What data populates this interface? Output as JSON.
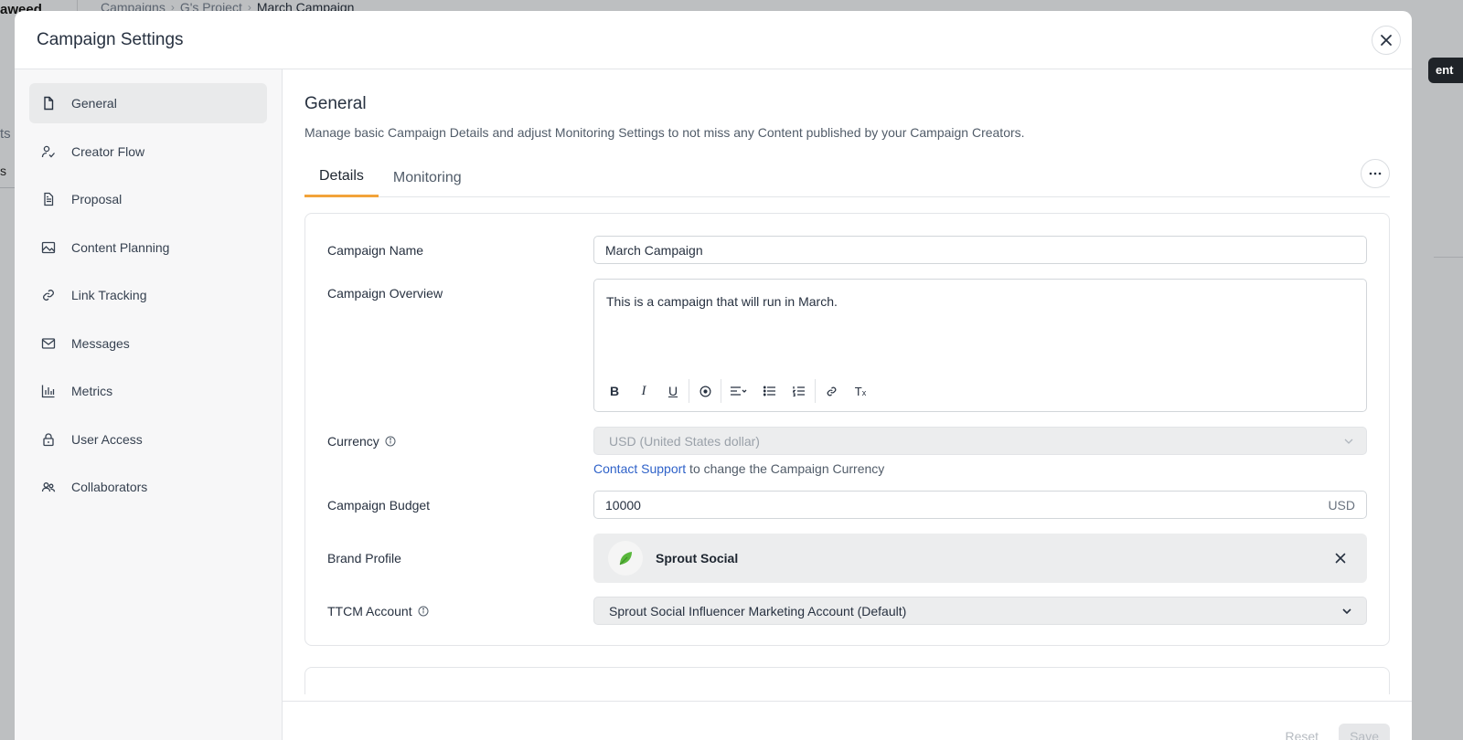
{
  "background": {
    "brand_partial": "aweed",
    "breadcrumbs": [
      "Campaigns",
      "G's Project",
      "March Campaign"
    ],
    "side_partial_1": "ts",
    "side_partial_2": "s",
    "dark_button_partial": "ent"
  },
  "modal": {
    "title": "Campaign Settings",
    "close_icon": "close-icon"
  },
  "sidebar": {
    "items": [
      {
        "label": "General",
        "icon": "file-icon",
        "active": true
      },
      {
        "label": "Creator Flow",
        "icon": "person-flow-icon",
        "active": false
      },
      {
        "label": "Proposal",
        "icon": "document-icon",
        "active": false
      },
      {
        "label": "Content Planning",
        "icon": "image-icon",
        "active": false
      },
      {
        "label": "Link Tracking",
        "icon": "link-icon",
        "active": false
      },
      {
        "label": "Messages",
        "icon": "envelope-icon",
        "active": false
      },
      {
        "label": "Metrics",
        "icon": "bar-chart-icon",
        "active": false
      },
      {
        "label": "User Access",
        "icon": "lock-icon",
        "active": false
      },
      {
        "label": "Collaborators",
        "icon": "people-icon",
        "active": false
      }
    ]
  },
  "general": {
    "title": "General",
    "description": "Manage basic Campaign Details and adjust Monitoring Settings to not miss any Content published by your Campaign Creators.",
    "tabs": [
      {
        "label": "Details",
        "active": true
      },
      {
        "label": "Monitoring",
        "active": false
      }
    ]
  },
  "form": {
    "campaign_name": {
      "label": "Campaign Name",
      "value": "March Campaign"
    },
    "campaign_overview": {
      "label": "Campaign Overview",
      "value": "This is a campaign that will run in March."
    },
    "currency": {
      "label": "Currency",
      "value": "USD (United States dollar)",
      "helper_link": "Contact Support",
      "helper_text": " to change the Campaign Currency"
    },
    "campaign_budget": {
      "label": "Campaign Budget",
      "value": "10000",
      "suffix": "USD"
    },
    "brand_profile": {
      "label": "Brand Profile",
      "value": "Sprout Social"
    },
    "ttcm_account": {
      "label": "TTCM Account",
      "value": "Sprout Social Influencer Marketing Account (Default)"
    }
  },
  "footer": {
    "reset_label": "Reset",
    "save_label": "Save"
  },
  "colors": {
    "accent_tab": "#f2a33a",
    "link": "#2f62c9",
    "brand_green": "#59b73c"
  }
}
